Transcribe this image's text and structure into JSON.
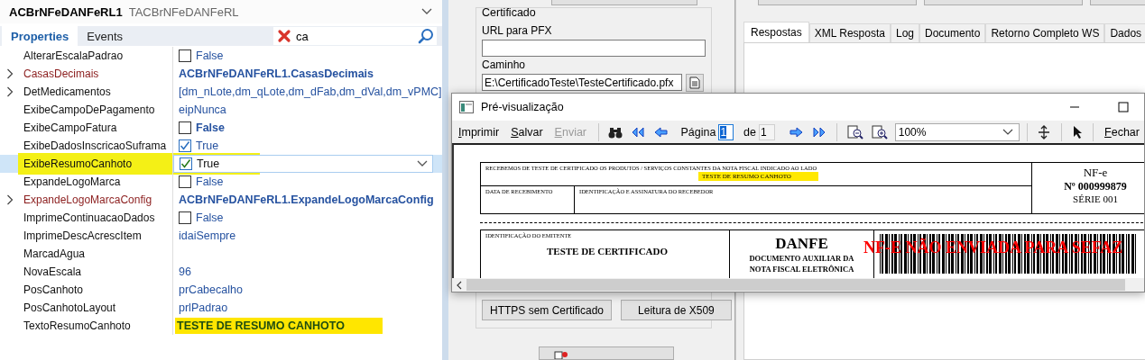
{
  "inspector": {
    "component_name": "ACBrNFeDANFeRL1",
    "component_type": "TACBrNFeDANFeRL",
    "tabs": [
      {
        "label": "Properties",
        "selected": true
      },
      {
        "label": "Events",
        "selected": false
      }
    ],
    "search": {
      "value": "ca"
    },
    "properties": [
      {
        "name": "AlterarEscalaPadrao",
        "kind": "bool",
        "checked": false,
        "value": "False",
        "selected": false
      },
      {
        "name": "CasasDecimais",
        "kind": "object",
        "value": "ACBrNFeDANFeRL1.CasasDecimais",
        "expandable": true,
        "selected": false
      },
      {
        "name": "DetMedicamentos",
        "kind": "plain",
        "value": "[dm_nLote,dm_qLote,dm_dFab,dm_dVal,dm_vPMC]",
        "expandable": true,
        "selected": false
      },
      {
        "name": "ExibeCampoDePagamento",
        "kind": "plain",
        "value": "eipNunca",
        "selected": false
      },
      {
        "name": "ExibeCampoFatura",
        "kind": "bool",
        "checked": false,
        "value": "False",
        "modified": true,
        "selected": false
      },
      {
        "name": "ExibeDadosInscricaoSuframa",
        "kind": "bool",
        "checked": true,
        "value": "True",
        "selected": false
      },
      {
        "name": "ExibeResumoCanhoto",
        "kind": "bool",
        "checked": true,
        "value": "True",
        "selected": true,
        "highlighted": true
      },
      {
        "name": "ExpandeLogoMarca",
        "kind": "bool",
        "checked": false,
        "value": "False",
        "selected": false
      },
      {
        "name": "ExpandeLogoMarcaConfig",
        "kind": "object",
        "value": "ACBrNFeDANFeRL1.ExpandeLogoMarcaConfig",
        "expandable": true,
        "selected": false
      },
      {
        "name": "ImprimeContinuacaoDados",
        "kind": "bool",
        "checked": false,
        "value": "False",
        "selected": false
      },
      {
        "name": "ImprimeDescAcrescItem",
        "kind": "plain",
        "value": "idaiSempre",
        "selected": false
      },
      {
        "name": "MarcadAgua",
        "kind": "plain",
        "selected": false
      },
      {
        "name": "NovaEscala",
        "kind": "plain",
        "value": "96",
        "selected": false
      },
      {
        "name": "PosCanhoto",
        "kind": "plain",
        "value": "prCabecalho",
        "selected": false
      },
      {
        "name": "PosCanhotoLayout",
        "kind": "plain",
        "value": "prlPadrao",
        "selected": false
      },
      {
        "name": "TextoResumoCanhoto",
        "kind": "plain",
        "value": "TESTE DE RESUMO CANHOTO",
        "modified": true,
        "selected": false,
        "highlighted": true
      }
    ]
  },
  "background_form": {
    "certificate_group": {
      "title": "Certificado",
      "url_label": "URL para PFX",
      "path_label": "Caminho",
      "path_value": "E:\\CertificadoTeste\\TesteCertificado.pfx"
    },
    "buttons": [
      "HTTPS sem Certificado",
      "Leitura de X509"
    ],
    "result_tabs": [
      {
        "label": "Respostas",
        "selected": true
      },
      {
        "label": "XML Resposta",
        "selected": false
      },
      {
        "label": "Log",
        "selected": false
      },
      {
        "label": "Documento",
        "selected": false
      },
      {
        "label": "Retorno Completo WS",
        "selected": false
      },
      {
        "label": "Dados",
        "selected": false
      }
    ]
  },
  "preview_window": {
    "title": "Pré-visualização",
    "toolbar": {
      "print": {
        "label": "Imprimir",
        "disabled": false
      },
      "save": {
        "label": "Salvar",
        "disabled": false
      },
      "send": {
        "label": "Enviar",
        "disabled": true
      },
      "page_label": "Página",
      "page_value": "1",
      "of_label": "de",
      "page_count": "1",
      "zoom": "100%",
      "close": "Fechar"
    },
    "document": {
      "receipt_text": "RECEBEMOS DE TESTE DE CERTIFICADO OS PRODUTOS / SERVIÇOS CONSTANTES DA NOTA FISCAL INDICADO AO LADO",
      "summary_text": "TESTE DE RESUMO CANHOTO",
      "summary_highlighted": true,
      "date_label": "DATA DE RECEBIMENTO",
      "signature_label": "IDENTIFICAÇÃO E ASSINATURA DO RECEBEDOR",
      "nfe_label": "NF-e",
      "nfe_number": "Nº 000999879",
      "series": "SÉRIE 001",
      "issuer_label": "IDENTIFICAÇÃO DO EMITENTE",
      "issuer_name": "TESTE DE CERTIFICADO",
      "danfe_title": "DANFE",
      "danfe_subtitle_1": "DOCUMENTO AUXILIAR DA",
      "danfe_subtitle_2": "NOTA FISCAL ELETRÔNICA",
      "watermark_text": "NF-E NÃO ENVIADA PARA SEFAZ"
    }
  }
}
